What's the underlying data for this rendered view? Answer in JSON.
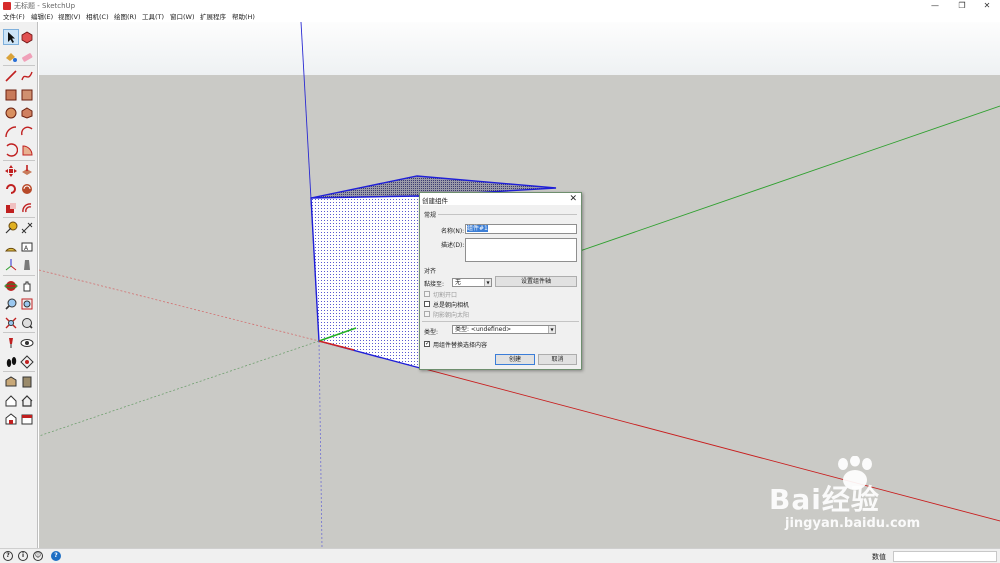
{
  "window": {
    "title": "无标题 - SketchUp",
    "minimize_glyph": "—",
    "maximize_glyph": "❐",
    "close_glyph": "✕"
  },
  "menu": [
    {
      "label": "文件(F)"
    },
    {
      "label": "编辑(E)"
    },
    {
      "label": "视图(V)"
    },
    {
      "label": "相机(C)"
    },
    {
      "label": "绘图(R)"
    },
    {
      "label": "工具(T)"
    },
    {
      "label": "窗口(W)"
    },
    {
      "label": "扩展程序"
    },
    {
      "label": "帮助(H)"
    }
  ],
  "toolbar_icons": [
    "select-icon",
    "make-component-icon",
    "paint-bucket-icon",
    "eraser-icon",
    "line-icon",
    "freehand-icon",
    "rectangle-icon",
    "rotated-rectangle-icon",
    "circle-icon",
    "polygon-icon",
    "arc-icon",
    "two-point-arc-icon",
    "three-point-arc-icon",
    "pie-icon",
    "move-icon",
    "push-pull-icon",
    "rotate-icon",
    "follow-me-icon",
    "scale-icon",
    "offset-icon",
    "tape-measure-icon",
    "dimension-icon",
    "protractor-icon",
    "text-icon",
    "axes-icon",
    "3d-text-icon",
    "orbit-icon",
    "pan-icon",
    "zoom-icon",
    "zoom-window-icon",
    "zoom-extents-icon",
    "previous-view-icon",
    "position-camera-icon",
    "look-around-icon",
    "walk-icon",
    "section-plane-icon",
    "warehouse-icon",
    "extension-warehouse-icon",
    "send-to-layout-icon",
    "house-icon",
    "component-house-icon",
    "building-icon"
  ],
  "dialog": {
    "title": "创建组件",
    "close_glyph": "✕",
    "section_general": "常规",
    "name_label": "名称(N):",
    "name_value": "组件#1",
    "description_label": "描述(D):",
    "description_value": "",
    "section_alignment": "对齐",
    "glue_to_label": "黏接至:",
    "glue_to_value": "无",
    "set_axes_button": "设置组件轴",
    "cut_opening_label": "切割开口",
    "cut_opening_checked": false,
    "always_face_camera_label": "总是朝向相机",
    "always_face_camera_checked": false,
    "shadows_face_sun_label": "阴影朝向太阳",
    "shadows_face_sun_checked": false,
    "type_label": "类型:",
    "type_value": "类型: <undefined>",
    "replace_selection_label": "用组件替换选择内容",
    "replace_selection_checked": true,
    "check_glyph": "✓",
    "combo_arrow_glyph": "▼",
    "create_button": "创建",
    "cancel_button": "取消"
  },
  "status": {
    "icon_geo_glyph": "?",
    "icon_credits_glyph": "i",
    "icon_user_glyph": "☺",
    "icon_help_glyph": "?",
    "measurements_label": "数值",
    "measurements_value": ""
  },
  "watermark": {
    "text": "Bai经验",
    "url": "jingyan.baidu.com"
  },
  "colors": {
    "axis_red": "#d22a2a",
    "axis_green": "#2fa02f",
    "axis_blue": "#2a2ad2",
    "selection_blue": "#1f1fd8",
    "ground": "#cacac6",
    "sky": "#f5f7f8"
  }
}
